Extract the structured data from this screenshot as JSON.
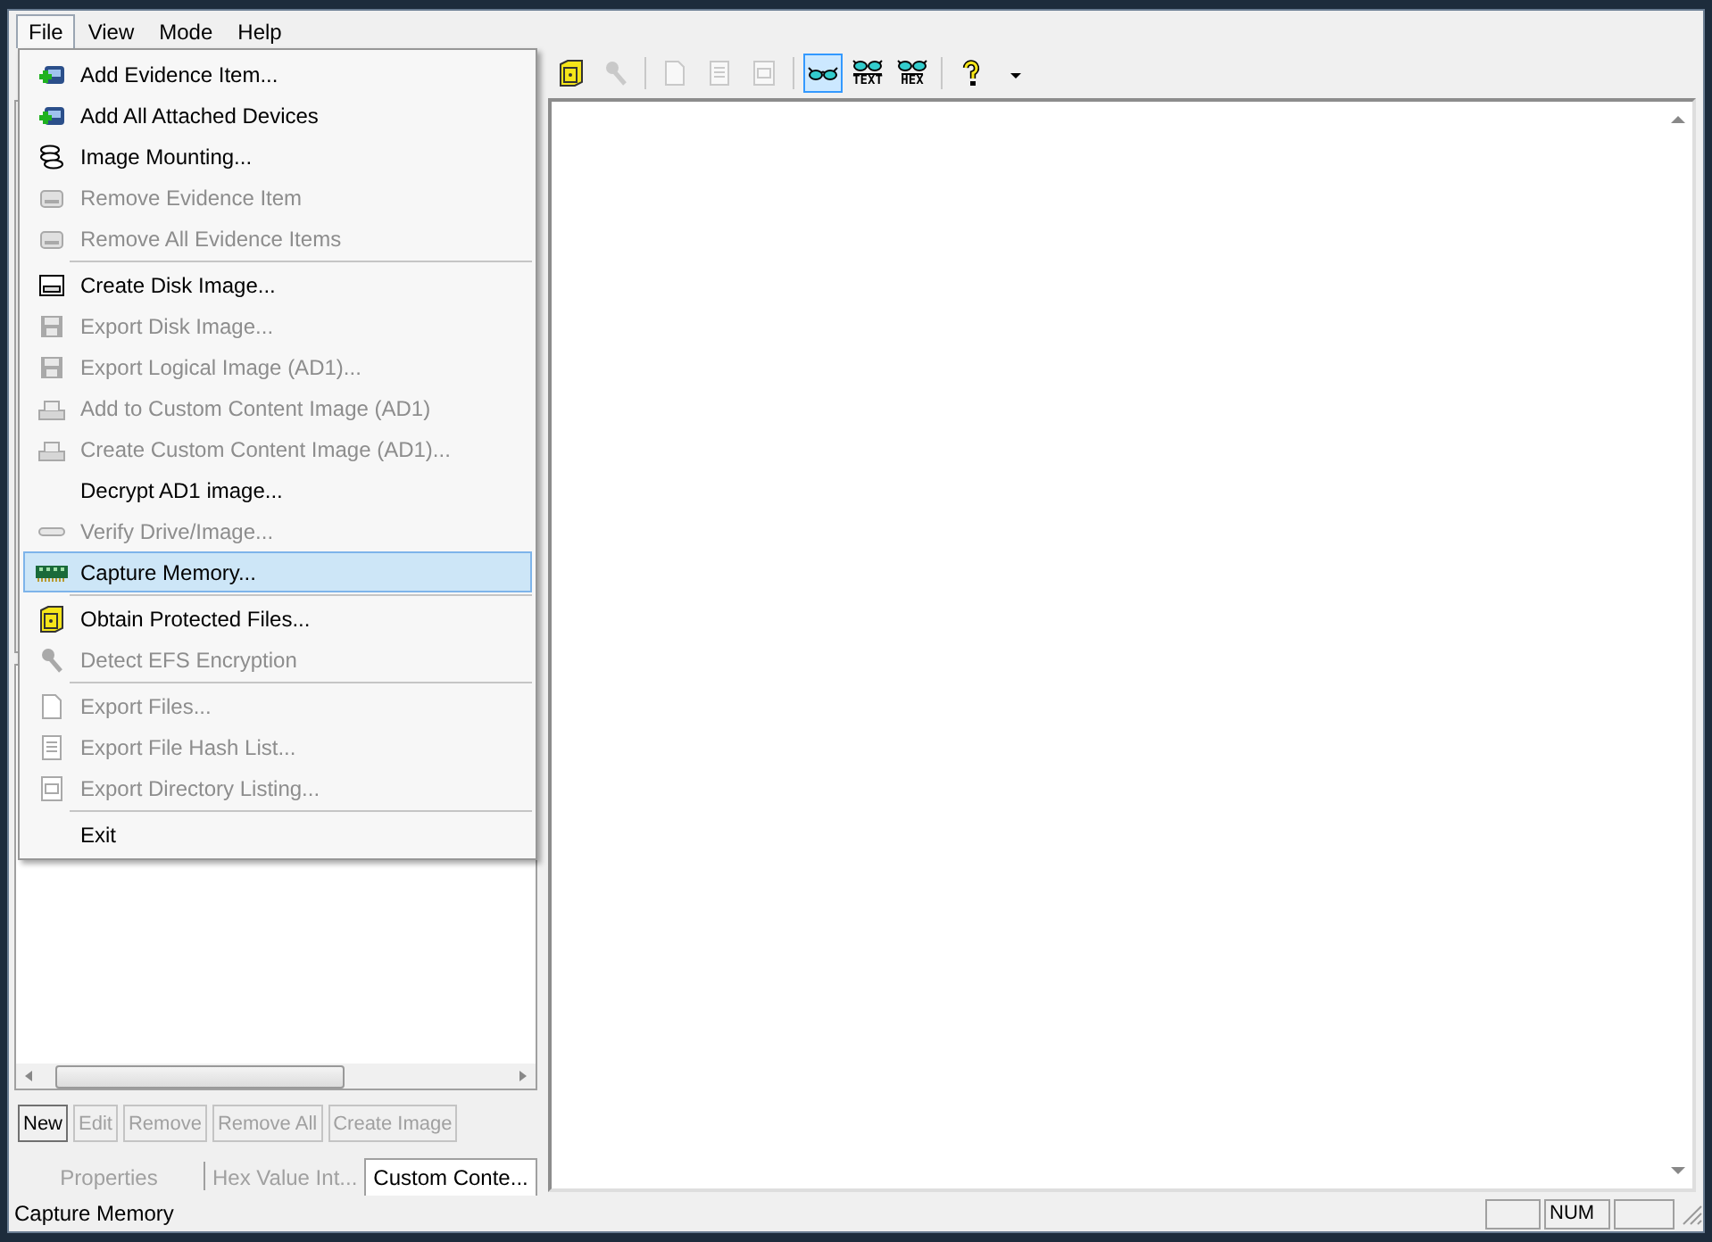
{
  "menubar": [
    {
      "label": "File",
      "selected": true
    },
    {
      "label": "View",
      "selected": false
    },
    {
      "label": "Mode",
      "selected": false
    },
    {
      "label": "Help",
      "selected": false
    }
  ],
  "file_menu": [
    {
      "kind": "item",
      "label": "Add Evidence Item...",
      "disabled": false,
      "selected": false
    },
    {
      "kind": "item",
      "label": "Add All Attached Devices",
      "disabled": false,
      "selected": false
    },
    {
      "kind": "item",
      "label": "Image Mounting...",
      "disabled": false,
      "selected": false
    },
    {
      "kind": "item",
      "label": "Remove Evidence Item",
      "disabled": true,
      "selected": false
    },
    {
      "kind": "item",
      "label": "Remove All Evidence Items",
      "disabled": true,
      "selected": false
    },
    {
      "kind": "separator"
    },
    {
      "kind": "item",
      "label": "Create Disk Image...",
      "disabled": false,
      "selected": false
    },
    {
      "kind": "item",
      "label": "Export Disk Image...",
      "disabled": true,
      "selected": false
    },
    {
      "kind": "item",
      "label": "Export Logical Image (AD1)...",
      "disabled": true,
      "selected": false
    },
    {
      "kind": "item",
      "label": "Add to Custom Content Image (AD1)",
      "disabled": true,
      "selected": false
    },
    {
      "kind": "item",
      "label": "Create Custom Content Image (AD1)...",
      "disabled": true,
      "selected": false
    },
    {
      "kind": "item",
      "label": "Decrypt AD1 image...",
      "disabled": false,
      "selected": false
    },
    {
      "kind": "item",
      "label": "Verify Drive/Image...",
      "disabled": true,
      "selected": false
    },
    {
      "kind": "item",
      "label": "Capture Memory...",
      "disabled": false,
      "selected": true
    },
    {
      "kind": "separator"
    },
    {
      "kind": "item",
      "label": "Obtain Protected Files...",
      "disabled": false,
      "selected": false
    },
    {
      "kind": "item",
      "label": "Detect EFS Encryption",
      "disabled": true,
      "selected": false
    },
    {
      "kind": "separator"
    },
    {
      "kind": "item",
      "label": "Export Files...",
      "disabled": true,
      "selected": false
    },
    {
      "kind": "item",
      "label": "Export File Hash List...",
      "disabled": true,
      "selected": false
    },
    {
      "kind": "item",
      "label": "Export Directory Listing...",
      "disabled": true,
      "selected": false
    },
    {
      "kind": "separator"
    },
    {
      "kind": "item",
      "label": "Exit",
      "disabled": false,
      "selected": false
    }
  ],
  "toolbar": [
    {
      "kind": "box",
      "disabled": false,
      "selected": false
    },
    {
      "kind": "key",
      "disabled": true,
      "selected": false
    },
    {
      "kind": "separator"
    },
    {
      "kind": "page",
      "disabled": true,
      "selected": false
    },
    {
      "kind": "lines",
      "disabled": true,
      "selected": false
    },
    {
      "kind": "dir",
      "disabled": true,
      "selected": false
    },
    {
      "kind": "separator"
    },
    {
      "kind": "glasses",
      "disabled": false,
      "selected": true
    },
    {
      "kind": "glasses-label",
      "label": "TEXT",
      "disabled": false,
      "selected": false
    },
    {
      "kind": "glasses-label",
      "label": "HEX",
      "disabled": false,
      "selected": false
    },
    {
      "kind": "separator"
    },
    {
      "kind": "help",
      "disabled": false,
      "selected": false
    },
    {
      "kind": "more",
      "disabled": false,
      "selected": false
    }
  ],
  "list_buttons": [
    {
      "label": "New",
      "disabled": false
    },
    {
      "label": "Edit",
      "disabled": true
    },
    {
      "label": "Remove",
      "disabled": true
    },
    {
      "label": "Remove All",
      "disabled": true
    },
    {
      "label": "Create Image",
      "disabled": true
    }
  ],
  "tabs": [
    {
      "label": "Properties",
      "selected": false
    },
    {
      "label": "Hex Value Int...",
      "selected": false
    },
    {
      "label": "Custom Conte...",
      "selected": true
    }
  ],
  "status_bar": {
    "message": "Capture Memory",
    "indicator": "NUM"
  }
}
